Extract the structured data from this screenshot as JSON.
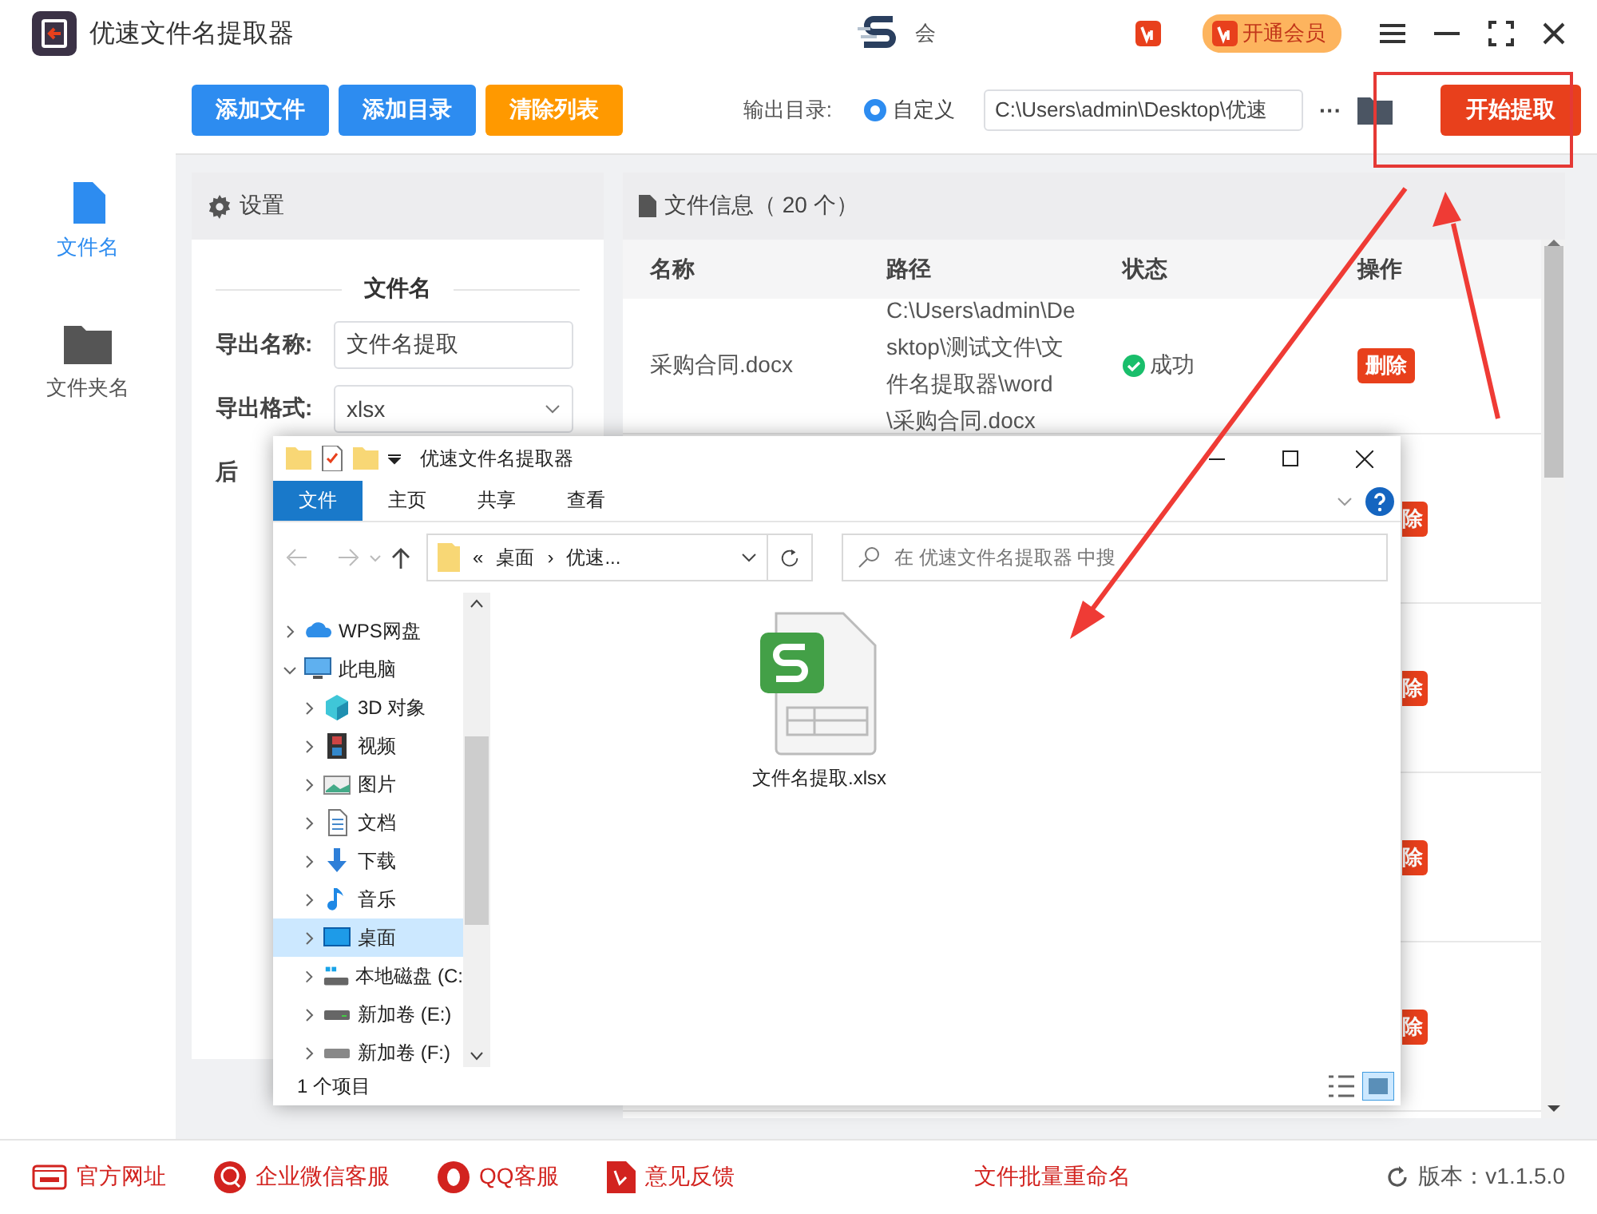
{
  "app": {
    "title": "优速文件名提取器",
    "user": "会",
    "vip_button": "开通会员"
  },
  "sidebar": {
    "items": [
      {
        "label": "文件名",
        "selected": true
      },
      {
        "label": "文件夹名",
        "selected": false
      }
    ]
  },
  "toolbar": {
    "buttons": [
      {
        "label": "添加文件",
        "kind": "primary"
      },
      {
        "label": "添加目录",
        "kind": "primary"
      },
      {
        "label": "清除列表",
        "kind": "warning"
      }
    ],
    "output_label": "输出目录:",
    "output_option": {
      "label": "自定义",
      "selected": true
    },
    "output_path": "C:\\Users\\admin\\Desktop\\优速",
    "more": "···",
    "start_button": "开始提取"
  },
  "settings": {
    "title": "设置",
    "section": "文件名",
    "fields": [
      {
        "label": "导出名称:",
        "kind": "input",
        "value": "文件名提取"
      },
      {
        "label": "导出格式:",
        "kind": "select",
        "value": "xlsx"
      },
      {
        "label": "后",
        "kind": "label"
      }
    ]
  },
  "file_info": {
    "title": "文件信息（ 20 个）",
    "columns": [
      "名称",
      "路径",
      "状态",
      "操作"
    ],
    "rows": [
      {
        "name": "采购合同.docx",
        "path": "C:\\Users\\admin\\Desktop\\测试文件\\文件名提取器\\word\\采购合同.docx",
        "status": "成功",
        "action": "删除"
      },
      {
        "action": "除"
      },
      {
        "action": "除"
      },
      {
        "action": "除"
      },
      {
        "action": "除"
      }
    ]
  },
  "explorer": {
    "title": "优速文件名提取器",
    "tabs": [
      {
        "label": "文件",
        "selected": true
      },
      {
        "label": "主页",
        "selected": false
      },
      {
        "label": "共享",
        "selected": false
      },
      {
        "label": "查看",
        "selected": false
      }
    ],
    "address": {
      "prefix": "«",
      "parts": [
        "桌面",
        "优速..."
      ],
      "separator": "›"
    },
    "search_placeholder": "在 优速文件名提取器 中搜",
    "tree": [
      {
        "label": "WPS网盘",
        "expanded": false,
        "selected": false
      },
      {
        "label": "此电脑",
        "expanded": true,
        "selected": false,
        "children": [
          {
            "label": "3D 对象",
            "expanded": false,
            "selected": false
          },
          {
            "label": "视频",
            "expanded": false,
            "selected": false
          },
          {
            "label": "图片",
            "expanded": false,
            "selected": false
          },
          {
            "label": "文档",
            "expanded": false,
            "selected": false
          },
          {
            "label": "下载",
            "expanded": false,
            "selected": false
          },
          {
            "label": "音乐",
            "expanded": false,
            "selected": false
          },
          {
            "label": "桌面",
            "expanded": false,
            "selected": true
          },
          {
            "label": "本地磁盘 (C:",
            "expanded": false,
            "selected": false
          },
          {
            "label": "新加卷 (E:)",
            "expanded": false,
            "selected": false
          },
          {
            "label": "新加卷 (F:)",
            "expanded": false,
            "selected": false
          }
        ]
      }
    ],
    "files": [
      {
        "name": "文件名提取.xlsx"
      }
    ],
    "status": "1 个项目"
  },
  "footer": {
    "links": [
      "官方网址",
      "企业微信客服",
      "QQ客服",
      "意见反馈"
    ],
    "center": "文件批量重命名",
    "version": "版本：v1.1.5.0"
  }
}
